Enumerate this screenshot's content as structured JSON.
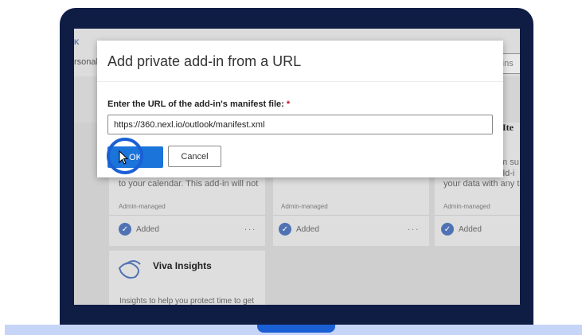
{
  "screen": {
    "corner_letter": "K",
    "tab_label": "rsonal",
    "search_text": "-ins",
    "right_title": "Ite"
  },
  "cards": [
    {
      "desc": "to your calendar. This add-in will not",
      "managed": "Admin-managed",
      "added": "Added",
      "more": "..."
    },
    {
      "managed": "Admin-managed",
      "added": "Added",
      "more": "..."
    },
    {
      "desc_line1": "m su",
      "desc_line2": "dd-i",
      "desc_line3": "your data with any th",
      "managed": "Admin-managed",
      "added": "Added"
    }
  ],
  "viva": {
    "title": "Viva Insights",
    "desc": "Insights to help you protect time to get"
  },
  "dialog": {
    "title": "Add private add-in from a URL",
    "field_label": "Enter the URL of the add-in's manifest file: ",
    "required_mark": "*",
    "url_value": "https://360.nexl.io/outlook/manifest.xml",
    "ok_label": "OK",
    "cancel_label": "Cancel"
  },
  "colors": {
    "bezel": "#0f1d45",
    "primary_button": "#1b74d9",
    "click_ring": "#1b5fd6",
    "base": "#c6d4f8"
  }
}
